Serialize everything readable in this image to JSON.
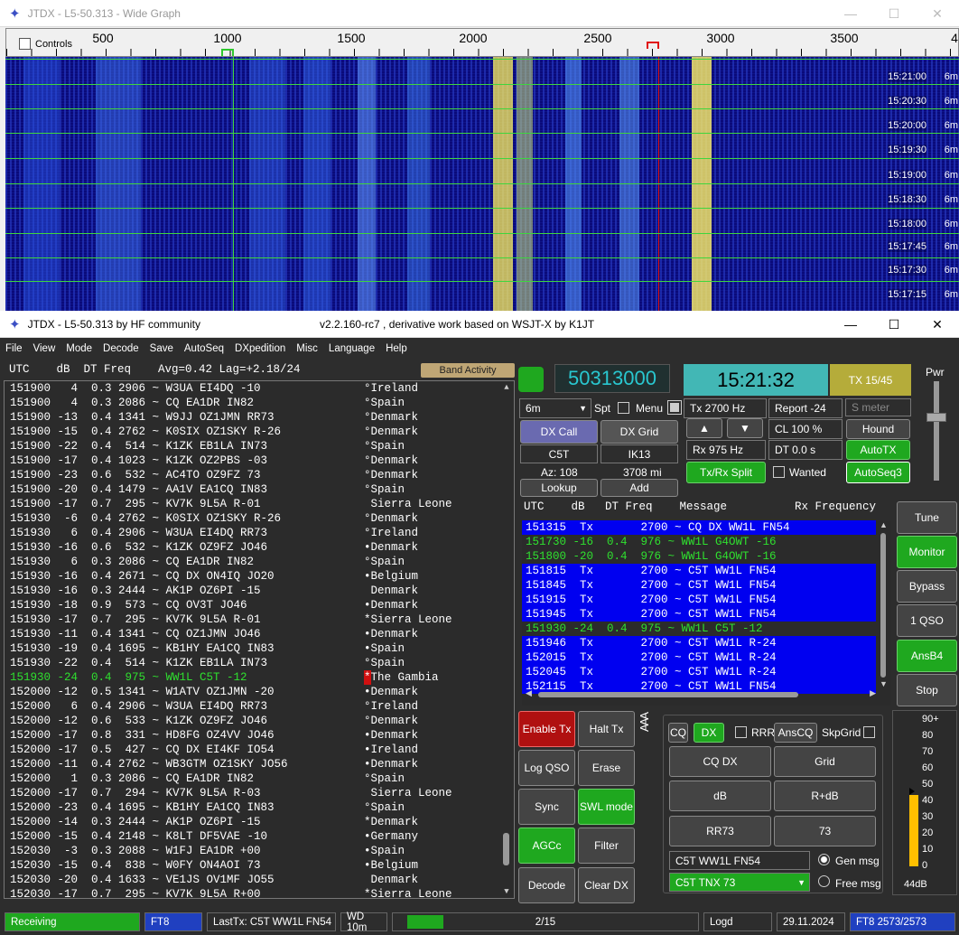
{
  "wide_graph": {
    "title": "JTDX - L5-50.313 - Wide Graph",
    "controls_label": "Controls",
    "axis_ticks": [
      "500",
      "1000",
      "1500",
      "2000",
      "2500",
      "3000",
      "3500",
      "4"
    ],
    "times": [
      "15:21:00",
      "15:20:30",
      "15:20:00",
      "15:19:30",
      "15:19:00",
      "15:18:30",
      "15:18:00",
      "15:17:45",
      "15:17:30",
      "15:17:15"
    ],
    "mode_tag": "6m"
  },
  "main": {
    "title": "JTDX - L5-50.313  by HF community",
    "version": "v2.2.160-rc7 , derivative work based on WSJT-X by K1JT",
    "menu": [
      "File",
      "View",
      "Mode",
      "Decode",
      "Save",
      "AutoSeq",
      "DXpedition",
      "Misc",
      "Language",
      "Help"
    ],
    "list_header": "UTC    dB  DT Freq    Avg=0.42 Lag=+2.18/24",
    "band_activity": "Band Activity",
    "decodes": [
      {
        "m": "151900   4  0.3 2906 ~ W3UA EI4DQ -10",
        "c": "°Ireland"
      },
      {
        "m": "151900   4  0.3 2086 ~ CQ EA1DR IN82",
        "c": "°Spain"
      },
      {
        "m": "151900 -13  0.4 1341 ~ W9JJ OZ1JMN RR73",
        "c": "°Denmark"
      },
      {
        "m": "151900 -15  0.4 2762 ~ K0SIX OZ1SKY R-26",
        "c": "°Denmark"
      },
      {
        "m": "151900 -22  0.4  514 ~ K1ZK EB1LA IN73",
        "c": "°Spain"
      },
      {
        "m": "151900 -17  0.4 1023 ~ K1ZK OZ2PBS -03",
        "c": "°Denmark"
      },
      {
        "m": "151900 -23  0.6  532 ~ AC4TO OZ9FZ 73",
        "c": "°Denmark"
      },
      {
        "m": "151900 -20  0.4 1479 ~ AA1V EA1CQ IN83",
        "c": "°Spain"
      },
      {
        "m": "151900 -17  0.7  295 ~ KV7K 9L5A R-01",
        "c": " Sierra Leone"
      },
      {
        "m": "151930  -6  0.4 2762 ~ K0SIX OZ1SKY R-26",
        "c": "°Denmark"
      },
      {
        "m": "151930   6  0.4 2906 ~ W3UA EI4DQ RR73",
        "c": "°Ireland"
      },
      {
        "m": "151930 -16  0.6  532 ~ K1ZK OZ9FZ JO46",
        "c": "•Denmark"
      },
      {
        "m": "151930   6  0.3 2086 ~ CQ EA1DR IN82",
        "c": "°Spain"
      },
      {
        "m": "151930 -16  0.4 2671 ~ CQ DX ON4IQ JO20",
        "c": "•Belgium"
      },
      {
        "m": "151930 -16  0.3 2444 ~ AK1P OZ6PI -15",
        "c": " Denmark"
      },
      {
        "m": "151930 -18  0.9  573 ~ CQ OV3T JO46",
        "c": "•Denmark"
      },
      {
        "m": "151930 -17  0.7  295 ~ KV7K 9L5A R-01",
        "c": "*Sierra Leone"
      },
      {
        "m": "151930 -11  0.4 1341 ~ CQ OZ1JMN JO46",
        "c": "•Denmark"
      },
      {
        "m": "151930 -19  0.4 1695 ~ KB1HY EA1CQ IN83",
        "c": "•Spain"
      },
      {
        "m": "151930 -22  0.4  514 ~ K1ZK EB1LA IN73",
        "c": "°Spain"
      },
      {
        "m": "151930 -24  0.4  975 ~ WW1L C5T -12",
        "c": "The Gambia",
        "hl": true,
        "star": "*"
      },
      {
        "m": "152000 -12  0.5 1341 ~ W1ATV OZ1JMN -20",
        "c": "•Denmark"
      },
      {
        "m": "152000   6  0.4 2906 ~ W3UA EI4DQ RR73",
        "c": "°Ireland"
      },
      {
        "m": "152000 -12  0.6  533 ~ K1ZK OZ9FZ JO46",
        "c": "°Denmark"
      },
      {
        "m": "152000 -17  0.8  331 ~ HD8FG OZ4VV JO46",
        "c": "•Denmark"
      },
      {
        "m": "152000 -17  0.5  427 ~ CQ DX EI4KF IO54",
        "c": "•Ireland"
      },
      {
        "m": "152000 -11  0.4 2762 ~ WB3GTM OZ1SKY JO56",
        "c": "•Denmark"
      },
      {
        "m": "152000   1  0.3 2086 ~ CQ EA1DR IN82",
        "c": "°Spain"
      },
      {
        "m": "152000 -17  0.7  294 ~ KV7K 9L5A R-03",
        "c": " Sierra Leone"
      },
      {
        "m": "152000 -23  0.4 1695 ~ KB1HY EA1CQ IN83",
        "c": "°Spain"
      },
      {
        "m": "152000 -14  0.3 2444 ~ AK1P OZ6PI -15",
        "c": "*Denmark"
      },
      {
        "m": "152000 -15  0.4 2148 ~ K8LT DF5VAE -10",
        "c": "•Germany"
      },
      {
        "m": "152030  -3  0.3 2088 ~ W1FJ EA1DR +00",
        "c": "•Spain"
      },
      {
        "m": "152030 -15  0.4  838 ~ W0FY ON4AOI 73",
        "c": "•Belgium"
      },
      {
        "m": "152030 -20  0.4 1633 ~ VE1JS OV1MF JO55",
        "c": " Denmark"
      },
      {
        "m": "152030 -17  0.7  295 ~ KV7K 9L5A R+00",
        "c": "*Sierra Leone"
      }
    ],
    "freq_display": "50313000",
    "clock": "15:21:32",
    "tx_period": "TX 15/45",
    "pwr_label": "Pwr",
    "band": "6m",
    "spt": "Spt",
    "menu_cb": "Menu",
    "tx_hz": "Tx  2700 Hz",
    "report": "Report -24",
    "s_meter_placeholder": "S meter",
    "dx_call_btn": "DX Call",
    "dx_grid_btn": "DX Grid",
    "dx_call": "C5T",
    "dx_grid": "IK13",
    "up": "▲",
    "down": "▼",
    "cl": "CL  100 %",
    "hound": "Hound",
    "az": "Az: 108",
    "dist": "3708 mi",
    "rx_hz": "Rx  975 Hz",
    "dt": "DT 0.0 s",
    "autotx": "AutoTX",
    "lookup": "Lookup",
    "add": "Add",
    "txrx_split": "Tx/Rx Split",
    "wanted": "Wanted",
    "autoseq3": "AutoSeq3",
    "qso_header": "UTC    dB   DT Freq    Message          Rx Frequency",
    "qso_rows": [
      {
        "t": "151315  Tx       2700 ~ CQ DX WW1L FN54",
        "k": "tx"
      },
      {
        "t": "151730 -16  0.4  976 ~ WW1L G4OWT -16",
        "k": "rx"
      },
      {
        "t": "151800 -20  0.4  976 ~ WW1L G4OWT -16",
        "k": "rx"
      },
      {
        "t": "151815  Tx       2700 ~ C5T WW1L FN54",
        "k": "tx"
      },
      {
        "t": "151845  Tx       2700 ~ C5T WW1L FN54",
        "k": "tx"
      },
      {
        "t": "151915  Tx       2700 ~ C5T WW1L FN54",
        "k": "tx"
      },
      {
        "t": "151945  Tx       2700 ~ C5T WW1L FN54",
        "k": "tx"
      },
      {
        "t": "151930 -24  0.4  975 ~ WW1L C5T -12",
        "k": "rx"
      },
      {
        "t": "151946  Tx       2700 ~ C5T WW1L R-24",
        "k": "tx"
      },
      {
        "t": "152015  Tx       2700 ~ C5T WW1L R-24",
        "k": "tx"
      },
      {
        "t": "152045  Tx       2700 ~ C5T WW1L R-24",
        "k": "tx"
      },
      {
        "t": "152115  Tx       2700 ~ C5T WW1L FN54",
        "k": "tx"
      }
    ],
    "side_btns": [
      "Tune",
      "Monitor",
      "Bypass",
      "1 QSO",
      "AnsB4",
      "Stop"
    ],
    "enable_tx": "Enable Tx",
    "halt_tx": "Halt Tx",
    "log_qso": "Log QSO",
    "erase": "Erase",
    "sync": "Sync",
    "swl_mode": "SWL mode",
    "agcc": "AGCc",
    "filter": "Filter",
    "decode": "Decode",
    "clear_dx": "Clear DX",
    "vertical_label": "AAA",
    "cq": "CQ",
    "dx": "DX",
    "rrr": "RRR",
    "anscq": "AnsCQ",
    "skpgrid": "SkpGrid",
    "msg_btns": [
      "CQ DX",
      "Grid",
      "dB",
      "R+dB",
      "RR73",
      "73"
    ],
    "gen_msg_text": "C5T WW1L FN54",
    "free_msg_text": "C5T TNX 73",
    "gen_msg": "Gen msg",
    "free_msg": "Free msg",
    "meter_scale": [
      "90+",
      "80",
      "70",
      "60",
      "50",
      "40",
      "30",
      "20",
      "10",
      "0"
    ],
    "meter_db": "44dB",
    "meter_level_db": 44,
    "status": {
      "receiving": "Receiving",
      "mode": "FT8",
      "last_tx": "LastTx: C5T WW1L FN54",
      "wd": "WD 10m",
      "progress": "2/15",
      "progress_fraction": 0.13,
      "logd": "Logd",
      "date": "29.11.2024",
      "count": "FT8  2573/2573"
    }
  }
}
